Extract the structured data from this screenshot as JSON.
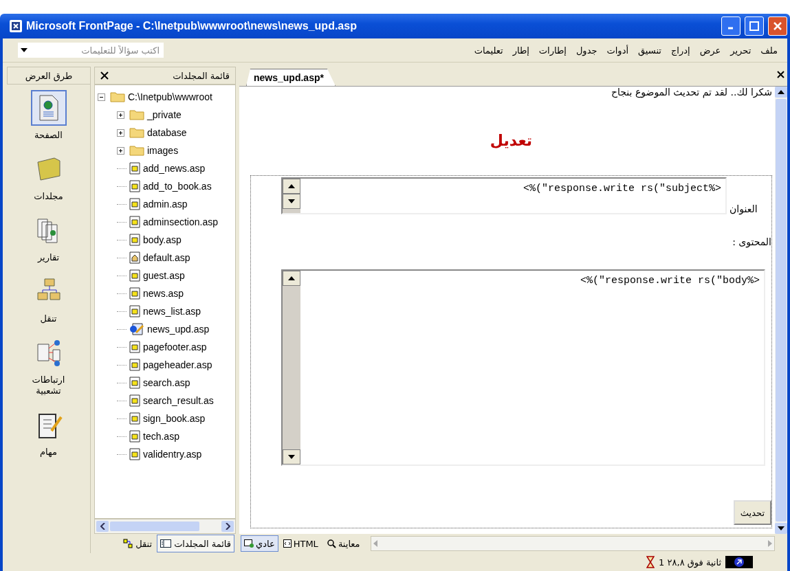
{
  "window": {
    "title": "Microsoft FrontPage - C:\\Inetpub\\wwwroot\\news\\news_upd.asp"
  },
  "help_box": {
    "placeholder": "اكتب سؤالاً للتعليمات"
  },
  "menu": [
    "ملف",
    "تحرير",
    "عرض",
    "إدراج",
    "تنسيق",
    "أدوات",
    "جدول",
    "إطارات",
    "إطار",
    "تعليمات"
  ],
  "views_bar": {
    "title": "طرق العرض",
    "items": [
      {
        "label": "الصفحة",
        "kind": "page",
        "selected": true
      },
      {
        "label": "مجلدات",
        "kind": "folders",
        "selected": false
      },
      {
        "label": "تقارير",
        "kind": "reports",
        "selected": false
      },
      {
        "label": "تنقل",
        "kind": "navigation",
        "selected": false
      },
      {
        "label": "ارتباطات تشعبية",
        "kind": "hyperlinks",
        "selected": false
      },
      {
        "label": "مهام",
        "kind": "tasks",
        "selected": false
      }
    ]
  },
  "folder_list": {
    "title": "قائمة المجلدات",
    "tree": {
      "label": "C:\\Inetpub\\wwwroot",
      "kind": "folder",
      "expanded": true,
      "children": [
        {
          "label": "_private",
          "kind": "folder",
          "expanded": false
        },
        {
          "label": "database",
          "kind": "folder",
          "expanded": false
        },
        {
          "label": "images",
          "kind": "folder",
          "expanded": false
        },
        {
          "label": "add_news.asp",
          "kind": "page"
        },
        {
          "label": "add_to_book.as",
          "kind": "page"
        },
        {
          "label": "admin.asp",
          "kind": "page"
        },
        {
          "label": "adminsection.asp",
          "kind": "page"
        },
        {
          "label": "body.asp",
          "kind": "page"
        },
        {
          "label": "default.asp",
          "kind": "home"
        },
        {
          "label": "guest.asp",
          "kind": "page"
        },
        {
          "label": "news.asp",
          "kind": "page"
        },
        {
          "label": "news_list.asp",
          "kind": "page"
        },
        {
          "label": "news_upd.asp",
          "kind": "editing"
        },
        {
          "label": "pagefooter.asp",
          "kind": "page"
        },
        {
          "label": "pageheader.asp",
          "kind": "page"
        },
        {
          "label": "search.asp",
          "kind": "page"
        },
        {
          "label": "search_result.as",
          "kind": "page"
        },
        {
          "label": "sign_book.asp",
          "kind": "page"
        },
        {
          "label": "tech.asp",
          "kind": "page"
        },
        {
          "label": "validentry.asp",
          "kind": "page"
        }
      ]
    },
    "tabs": [
      {
        "label": "قائمة المجلدات",
        "kind": "folders",
        "selected": true
      },
      {
        "label": "تنقل",
        "kind": "navigation",
        "selected": false
      }
    ]
  },
  "editor": {
    "tab": "news_upd.asp*",
    "message": "شكرا لك.. لقد تم تحديث الموضوع بنجاح",
    "heading": "تعديل",
    "fields": [
      {
        "label": "العنوان",
        "value": "<%(\"response.write rs(\"subject%>",
        "kind": "single"
      },
      {
        "label": "المحتوى :",
        "value": "<%(\"response.write rs(\"body%>",
        "kind": "multi"
      }
    ],
    "submit": "تحديث",
    "view_tabs": [
      {
        "label": "معاينة",
        "kind": "preview",
        "selected": false
      },
      {
        "label": "HTML",
        "kind": "html",
        "selected": false
      },
      {
        "label": "عادي",
        "kind": "normal",
        "selected": true
      }
    ]
  },
  "status_bar": {
    "time": "ثانية فوق ٢٨,٨ 1"
  }
}
